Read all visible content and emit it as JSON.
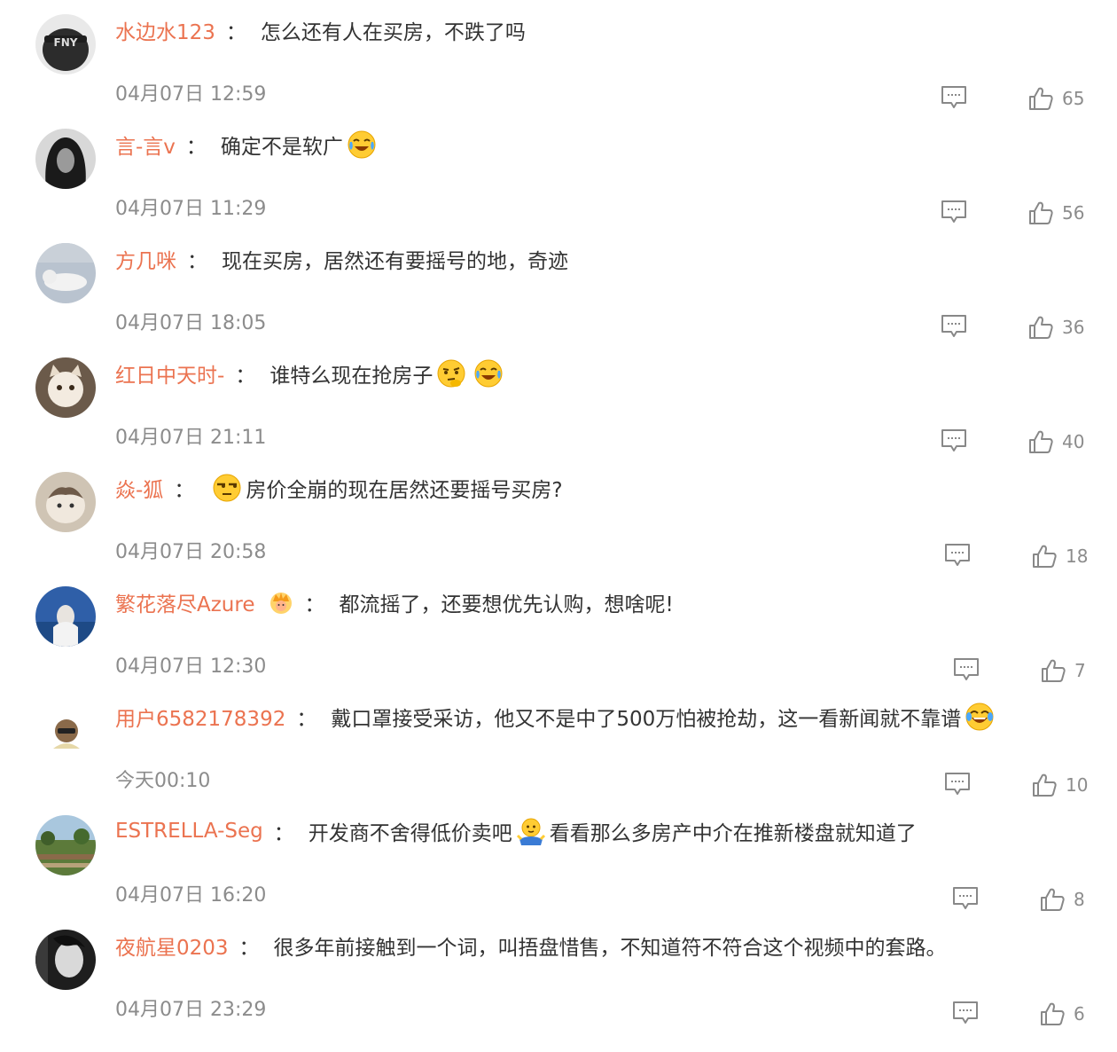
{
  "separator": "：",
  "comments": [
    {
      "username": "水边水123",
      "parts": [
        "怎么还有人在买房，不跌了吗"
      ],
      "time": "04月07日 12:59",
      "likes": "65",
      "avatar": "cap-icon"
    },
    {
      "username": "言-言v",
      "parts": [
        "确定不是软广"
      ],
      "emojis": [
        "laugh-cry-emoji"
      ],
      "time": "04月07日 11:29",
      "likes": "56",
      "avatar": "long-hair-portrait"
    },
    {
      "username": "方几咪",
      "parts": [
        "现在买房，居然还有要摇号的地，奇迹"
      ],
      "time": "04月07日 18:05",
      "likes": "36",
      "avatar": "sleeping-cat"
    },
    {
      "username": "红日中天时-",
      "parts": [
        "谁特么现在抢房子"
      ],
      "emojis": [
        "thinking-emoji",
        "laugh-cry-emoji"
      ],
      "time": "04月07日 21:11",
      "likes": "40",
      "avatar": "kitten"
    },
    {
      "username": "焱-狐",
      "parts": [
        "房价全崩的现在居然还要摇号买房?"
      ],
      "emojis": [
        "side-eye-emoji"
      ],
      "time": "04月07日 20:58",
      "likes": "18",
      "avatar": "cat"
    },
    {
      "username": "繁花落尽Azure",
      "parts": [
        "都流摇了，还要想优先认购，想啥呢!"
      ],
      "badge": "crown-badge-icon",
      "time": "04月07日 12:30",
      "likes": "7",
      "avatar": "water-portrait"
    },
    {
      "username": "用户6582178392",
      "parts": [
        "戴口罩接受采访，他又不是中了500万怕被抢劫，这一看新闻就不靠谱"
      ],
      "emojis": [
        "tears-of-joy-emoji"
      ],
      "time": "今天00:10",
      "likes": "10",
      "avatar": "cartoon-character"
    },
    {
      "username": "ESTRELLA-Seg",
      "parts": [
        "开发商不舍得低价卖吧",
        "看看那么多房产中介在推新楼盘就知道了"
      ],
      "emojis": [
        "shrug-emoji"
      ],
      "time": "04月07日 16:20",
      "likes": "8",
      "avatar": "garden"
    },
    {
      "username": "夜航星0203",
      "parts": [
        "很多年前接触到一个词，叫捂盘惜售，不知道符不符合这个视频中的套路。"
      ],
      "time": "04月07日 23:29",
      "likes": "6",
      "avatar": "bw-portrait"
    }
  ]
}
